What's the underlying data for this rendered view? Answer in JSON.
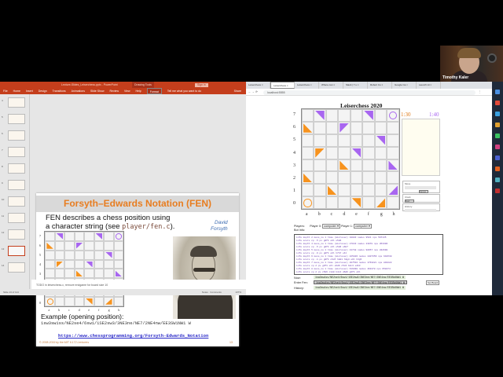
{
  "webcam": {
    "participant_name": "Timothy Kaler"
  },
  "powerpoint": {
    "title": "Lecture-Slides_Leiserchess.pptx - PowerPoint",
    "contextual_tab": "Drawing Tools",
    "sign_in": "Sign in",
    "ribbon_tabs": [
      "File",
      "Home",
      "Insert",
      "Design",
      "Transitions",
      "Animations",
      "Slide Show",
      "Review",
      "View",
      "Help",
      "Format"
    ],
    "tell_me": "Tell me what you want to do",
    "share": "Share",
    "thumb_numbers": [
      "4",
      "5",
      "6",
      "7",
      "8",
      "9",
      "10",
      "11",
      "12",
      "13",
      "14"
    ],
    "slide": {
      "title": "Forsyth–Edwards Notation (FEN)",
      "body_line1": "FEN describes a chess position using",
      "body_line2_prefix": "a character string (see ",
      "body_code": "player/fen.c",
      "body_line2_suffix": ").",
      "author_first": "David",
      "author_last": "Forsyth",
      "example_label": "Example (opening position):",
      "example_fen": "1sw3sw1ss/NE2se4/6sw1/1SE2sw3/3NE3ne/NE7/2NE4nw/EE3SW1NW1 W",
      "link": "https://www.chessprogramming.org/Forsyth-Edwards_Notation",
      "copyright": "© 2008-2019 by the MIT 6.172 Lecturers",
      "page_number": "13"
    },
    "notes": "TODO in leiserchess.c, remove endgame for board size 10",
    "status": {
      "slide_info": "Slide 13 of 114",
      "notes": "Notes",
      "comments": "Comments",
      "zoom": "137%"
    }
  },
  "browser": {
    "tabs": [
      "Leiserchess",
      "Leiserchess",
      "Leiserchess",
      "Where can",
      "Slack | 7 u",
      "Robert Cu",
      "Google Ca",
      "Launch Hi"
    ],
    "active_tab": 1,
    "url": "localhost:5555",
    "page": {
      "title": "Leiserchess 2020",
      "timer_orange": "1:30",
      "timer_purple": "1:40",
      "move_legend": "Move",
      "cancel": "Cancel",
      "clock_legend": "Clock",
      "start": "Start",
      "history_legend": "History",
      "players_label": "Players:",
      "player0_label": "Player 0:",
      "player0_value": "computer",
      "player1_label": "Player 1:",
      "player1_value": "computer",
      "bot_info_label": "Bot Info:",
      "log_lines": [
        "info depth 2 move_no 1 time (microsec) 10083 nodes 9521 nps 597135",
        "info score cp -5 pv g0f1 e6l e5d6",
        "info depth 4 move_no 1 time (microsec) 27043 nodes 23078 nps 853306",
        "info score cp -5 pv g0f1 e6l e5d6 e6b7",
        "info depth 5 move_no 1 time (microsec) 44748 nodes 98657 nps 832690",
        "info score cp -6 pv g0f1 e6l h7b7 e6l",
        "info depth 6 move_no 1 time (microsec) 225826 nodes 1407356 nps 648538",
        "info score cp -1 pv g0f1 c6d7 h0d1 h3g4 e6l h3g5",
        "info depth 7 move_no 1 time (microsec) 207532 nodes 176322n nps 846222",
        "info score cp 2 pv g0f1 e6l e6d6 c5c6 b4c3 e2b3",
        "info depth 8 move_no 1 time (microsec) 616898 nodes 463478 nps 650474",
        "info score cp 2 pv c5d6 c1d8 b4c4 d6d6 g0f1 e6l",
        "bestmove f0d1"
      ],
      "now_label": "Now:",
      "now_fen": "1sw3sw1ss/NE2se4/6sw1/1SE2sw3/3NE3ne/NE7/2NE4nw/EE3SW1NW1 W",
      "enter_fen_label": "Enter Fen:",
      "enter_fen_value": "1sw3sw1ss/NE2se4/6sw1/1SE2sw3/3NE3ne/NE7/2NE4nw/EE3SW1NW1 W",
      "set_board": "Set Board",
      "history_label": "History:",
      "history_fen": "1sw3sw1ss/NE2se4/6sw1/1SE2sw3/3NE3ne/NE7/2NE4nw/EE3SW1NW1 W"
    }
  },
  "board": {
    "files": [
      "a",
      "b",
      "c",
      "d",
      "e",
      "f",
      "g",
      "h"
    ],
    "ranks": [
      "7",
      "6",
      "5",
      "4",
      "3",
      "2",
      "1",
      "0"
    ],
    "colors": {
      "orange": "#f7931e",
      "purple": "#a866f0"
    },
    "pieces": [
      {
        "sq": "b7",
        "side": "purple",
        "corner": "tr"
      },
      {
        "sq": "f7",
        "side": "purple",
        "corner": "tr"
      },
      {
        "sq": "h7",
        "side": "purple",
        "king": true
      },
      {
        "sq": "a6",
        "side": "orange",
        "corner": "bl"
      },
      {
        "sq": "d6",
        "side": "purple",
        "corner": "tl"
      },
      {
        "sq": "g5",
        "side": "purple",
        "corner": "tr"
      },
      {
        "sq": "b4",
        "side": "orange",
        "corner": "tl"
      },
      {
        "sq": "e4",
        "side": "purple",
        "corner": "tr"
      },
      {
        "sq": "d3",
        "side": "orange",
        "corner": "bl"
      },
      {
        "sq": "h3",
        "side": "purple",
        "corner": "bl"
      },
      {
        "sq": "a2",
        "side": "orange",
        "corner": "bl"
      },
      {
        "sq": "c1",
        "side": "orange",
        "corner": "bl"
      },
      {
        "sq": "h1",
        "side": "purple",
        "corner": "br"
      },
      {
        "sq": "a0",
        "side": "orange",
        "king": true
      },
      {
        "sq": "e0",
        "side": "orange",
        "corner": "tr"
      },
      {
        "sq": "g0",
        "side": "orange",
        "corner": "br"
      }
    ]
  }
}
